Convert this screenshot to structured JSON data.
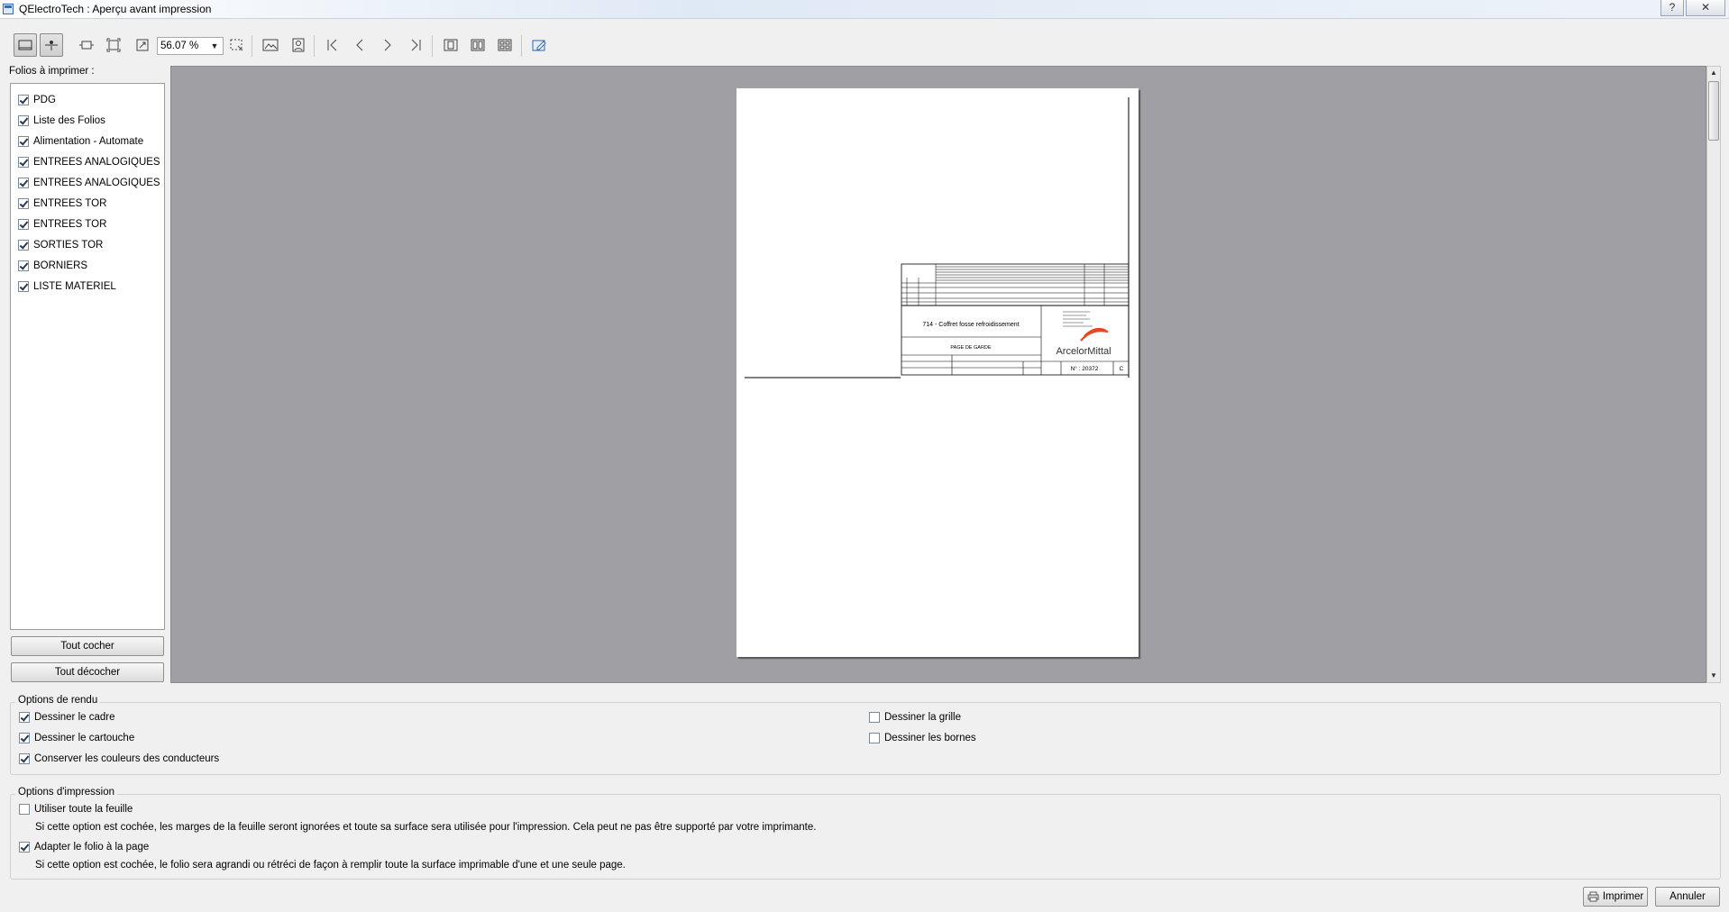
{
  "window": {
    "title": "QElectroTech : Aperçu avant impression",
    "help_label": "?",
    "close_label": "✕"
  },
  "toolbar": {
    "zoom_value": "56.07 %",
    "icons": [
      "single-page-icon",
      "page-setup-icon",
      "fit-width-icon",
      "fit-page-icon",
      "zoom-in-out-icon",
      "zoom-rect-icon",
      "landscape-icon",
      "portrait-icon",
      "first-page-icon",
      "previous-page-icon",
      "next-page-icon",
      "last-page-icon",
      "single-view-icon",
      "facing-pages-icon",
      "all-pages-icon",
      "page-setup-edit-icon"
    ]
  },
  "folios": {
    "label": "Folios à imprimer :",
    "items": [
      {
        "label": "PDG",
        "checked": true
      },
      {
        "label": "Liste des Folios",
        "checked": true
      },
      {
        "label": "Alimentation - Automate",
        "checked": true
      },
      {
        "label": "ENTREES ANALOGIQUES",
        "checked": true
      },
      {
        "label": "ENTREES ANALOGIQUES",
        "checked": true
      },
      {
        "label": "ENTREES TOR",
        "checked": true
      },
      {
        "label": "ENTREES TOR",
        "checked": true
      },
      {
        "label": "SORTIES TOR",
        "checked": true
      },
      {
        "label": "BORNIERS",
        "checked": true
      },
      {
        "label": "LISTE MATERIEL",
        "checked": true
      }
    ],
    "check_all_label": "Tout cocher",
    "uncheck_all_label": "Tout décocher"
  },
  "preview": {
    "titleblock_title": "714 - Coffret fosse refroidissement",
    "titleblock_subtitle": "PAGE DE GARDE",
    "logo_text": "ArcelorMittal",
    "doc_number": "N° : 20372",
    "revision": "C"
  },
  "render_options": {
    "title": "Options de rendu",
    "draw_frame": {
      "label": "Dessiner le cadre",
      "checked": true
    },
    "draw_titleblock": {
      "label": "Dessiner le cartouche",
      "checked": true
    },
    "keep_colors": {
      "label": "Conserver les couleurs des conducteurs",
      "checked": true
    },
    "draw_grid": {
      "label": "Dessiner la grille",
      "checked": false
    },
    "draw_terminals": {
      "label": "Dessiner les bornes",
      "checked": false
    }
  },
  "print_options": {
    "title": "Options d'impression",
    "full_page": {
      "label": "Utiliser toute la feuille",
      "checked": false
    },
    "full_page_note": "Si cette option est cochée, les marges de la feuille seront ignorées et toute sa surface sera utilisée pour l'impression. Cela peut ne pas être supporté par votre imprimante.",
    "fit_page": {
      "label": "Adapter le folio à la page",
      "checked": true
    },
    "fit_page_note": "Si cette option est cochée, le folio sera agrandi ou rétréci de façon à remplir toute la surface imprimable d'une et une seule page."
  },
  "footer": {
    "print_label": "Imprimer",
    "cancel_label": "Annuler"
  }
}
